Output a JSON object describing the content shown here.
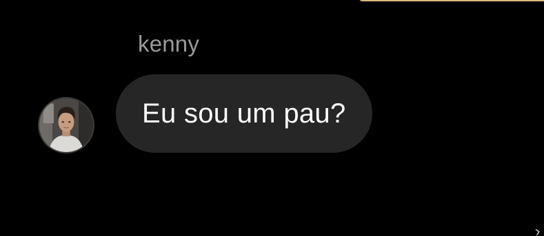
{
  "conversation": {
    "sender_name": "kenny",
    "message_text": "Eu sou um pau?"
  },
  "icons": {
    "avatar": "profile-photo",
    "corner": "chevron-right-icon"
  },
  "colors": {
    "background": "#000000",
    "bubble": "#262626",
    "sender_name": "#9a9a9a",
    "message_text": "#ffffff",
    "top_accent": "#d9b878"
  }
}
